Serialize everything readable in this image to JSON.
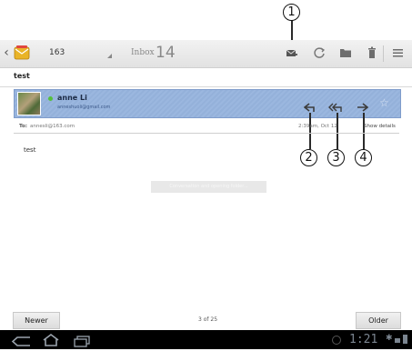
{
  "annotations": {
    "callout_1": "1",
    "callout_2": "2",
    "callout_3": "3",
    "callout_4": "4"
  },
  "actionbar": {
    "account": "163",
    "folder": "Inbox",
    "unread_count": "14",
    "icons": [
      "compose-icon",
      "refresh-icon",
      "folder-icon",
      "delete-icon",
      "menu-icon"
    ]
  },
  "message": {
    "subject": "test",
    "sender_name": "anne Li",
    "sender_email": "anneshuoli@gmail.com",
    "to_label": "To:",
    "to_value": "annesli@163.com",
    "date": "2:39am, Oct 12",
    "show_details": "Show details",
    "body": "test"
  },
  "toast": "Conversation and opening folder...",
  "pager": {
    "newer": "Newer",
    "position": "3 of 25",
    "older": "Older"
  },
  "statusbar": {
    "time": "1:21"
  },
  "colors": {
    "header_blue": "#9bb7df",
    "online_dot": "#55c13b",
    "accent": "#3c3c3c"
  }
}
